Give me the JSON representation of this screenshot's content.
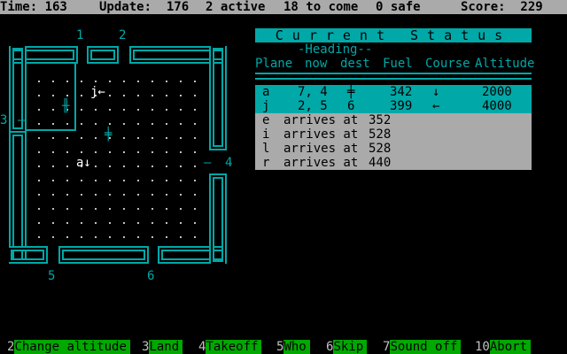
{
  "statusbar": {
    "time": "Time: 163",
    "update": "Update:  176",
    "active": "2 active",
    "tocome": "18 to come",
    "safe": "0 safe",
    "score": "Score:  229"
  },
  "gates": {
    "g1": "1",
    "g2": "2",
    "g3": "3",
    "g4": "4",
    "g5": "5",
    "g6": "6"
  },
  "airspace": {
    "plane_j": "j←",
    "plane_a": "a↓",
    "airport_a": "╫",
    "airport_b": "╪"
  },
  "panel": {
    "title": "Current Status",
    "heading": "-Heading--",
    "col_plane": "Plane",
    "col_now": "now",
    "col_dest": "dest",
    "col_fuel": "Fuel",
    "col_course": "Course",
    "col_alt": "Altitude",
    "active": [
      {
        "plane": "a",
        "now": "7, 4",
        "dest": "╪",
        "fuel": "342",
        "course": "↓",
        "alt": "2000"
      },
      {
        "plane": "j",
        "now": "2, 5",
        "dest": "6",
        "fuel": "399",
        "course": "←",
        "alt": "4000"
      }
    ],
    "arrivals": [
      {
        "plane": "e",
        "text": "arrives at",
        "time": "352"
      },
      {
        "plane": "i",
        "text": "arrives at",
        "time": "528"
      },
      {
        "plane": "l",
        "text": "arrives at",
        "time": "528"
      },
      {
        "plane": "r",
        "text": "arrives at",
        "time": "440"
      }
    ]
  },
  "keys": [
    {
      "num": "2",
      "label": "Change altitude"
    },
    {
      "num": "3",
      "label": "Land"
    },
    {
      "num": "4",
      "label": "Takeoff"
    },
    {
      "num": "5",
      "label": "Who"
    },
    {
      "num": "6",
      "label": "Skip"
    },
    {
      "num": "7",
      "label": "Sound off"
    },
    {
      "num": "10",
      "label": "Abort"
    }
  ]
}
